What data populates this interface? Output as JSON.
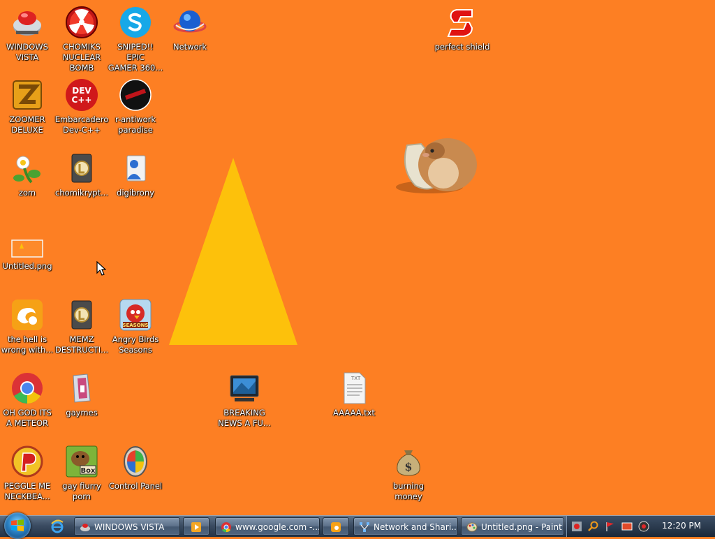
{
  "desktop": {
    "icons": {
      "windows_vista": "WINDOWS\nVISTA",
      "chomiks_nuclear_bomb": "CHOMIKS\nNUCLEAR\nBOMB",
      "sniped_epic_gamer": "SNIPED!! EPIC\nGAMER 360...",
      "network": "Network",
      "perfect_shield": "perfect shield",
      "zoomer_deluxe": "ZOOMER\nDELUXE",
      "dev_cpp": "Embarcadero\nDev-C++",
      "r_antiwork": "r-antiwork\nparadise",
      "zom": "zom",
      "chomikrypt": "chomikrypt...",
      "digibrony": "digibrony",
      "untitled_png": "Untitled.png",
      "uc_browser": "the hell is\nwrong with...",
      "memz": "MEMZ\nDESTRUCTI...",
      "angry_birds": "Angry Birds\nSeasons",
      "chrome": "OH GOD ITS\nA METEOR",
      "gaymes": "gaymes",
      "breaking_news": "BREAKING\nNEWS A FU...",
      "aaaaa_txt": "AAAAA.txt",
      "peggle": "PEGGLE ME\nNECKBEA...",
      "gay_fiurry": "gay fiurry\nporn",
      "control_panel": "Control Panel",
      "burning_money": "burning\nmoney"
    },
    "icon_badges": {
      "dev_cpp": "DEV\nC++",
      "box": "Box",
      "seasons": "SEASONS",
      "txt": "TXT"
    }
  },
  "taskbar": {
    "buttons": [
      {
        "label": "WINDOWS VISTA"
      },
      {
        "label": ""
      },
      {
        "label": "www.google.com -..."
      },
      {
        "label": ""
      },
      {
        "label": "Network and Shari..."
      },
      {
        "label": "Untitled.png - Paint"
      }
    ],
    "clock": "12:20 PM"
  },
  "colors": {
    "desktop_background": "#fd7f23",
    "triangle": "#fdc10b",
    "taskbar": "#3b4c62"
  }
}
